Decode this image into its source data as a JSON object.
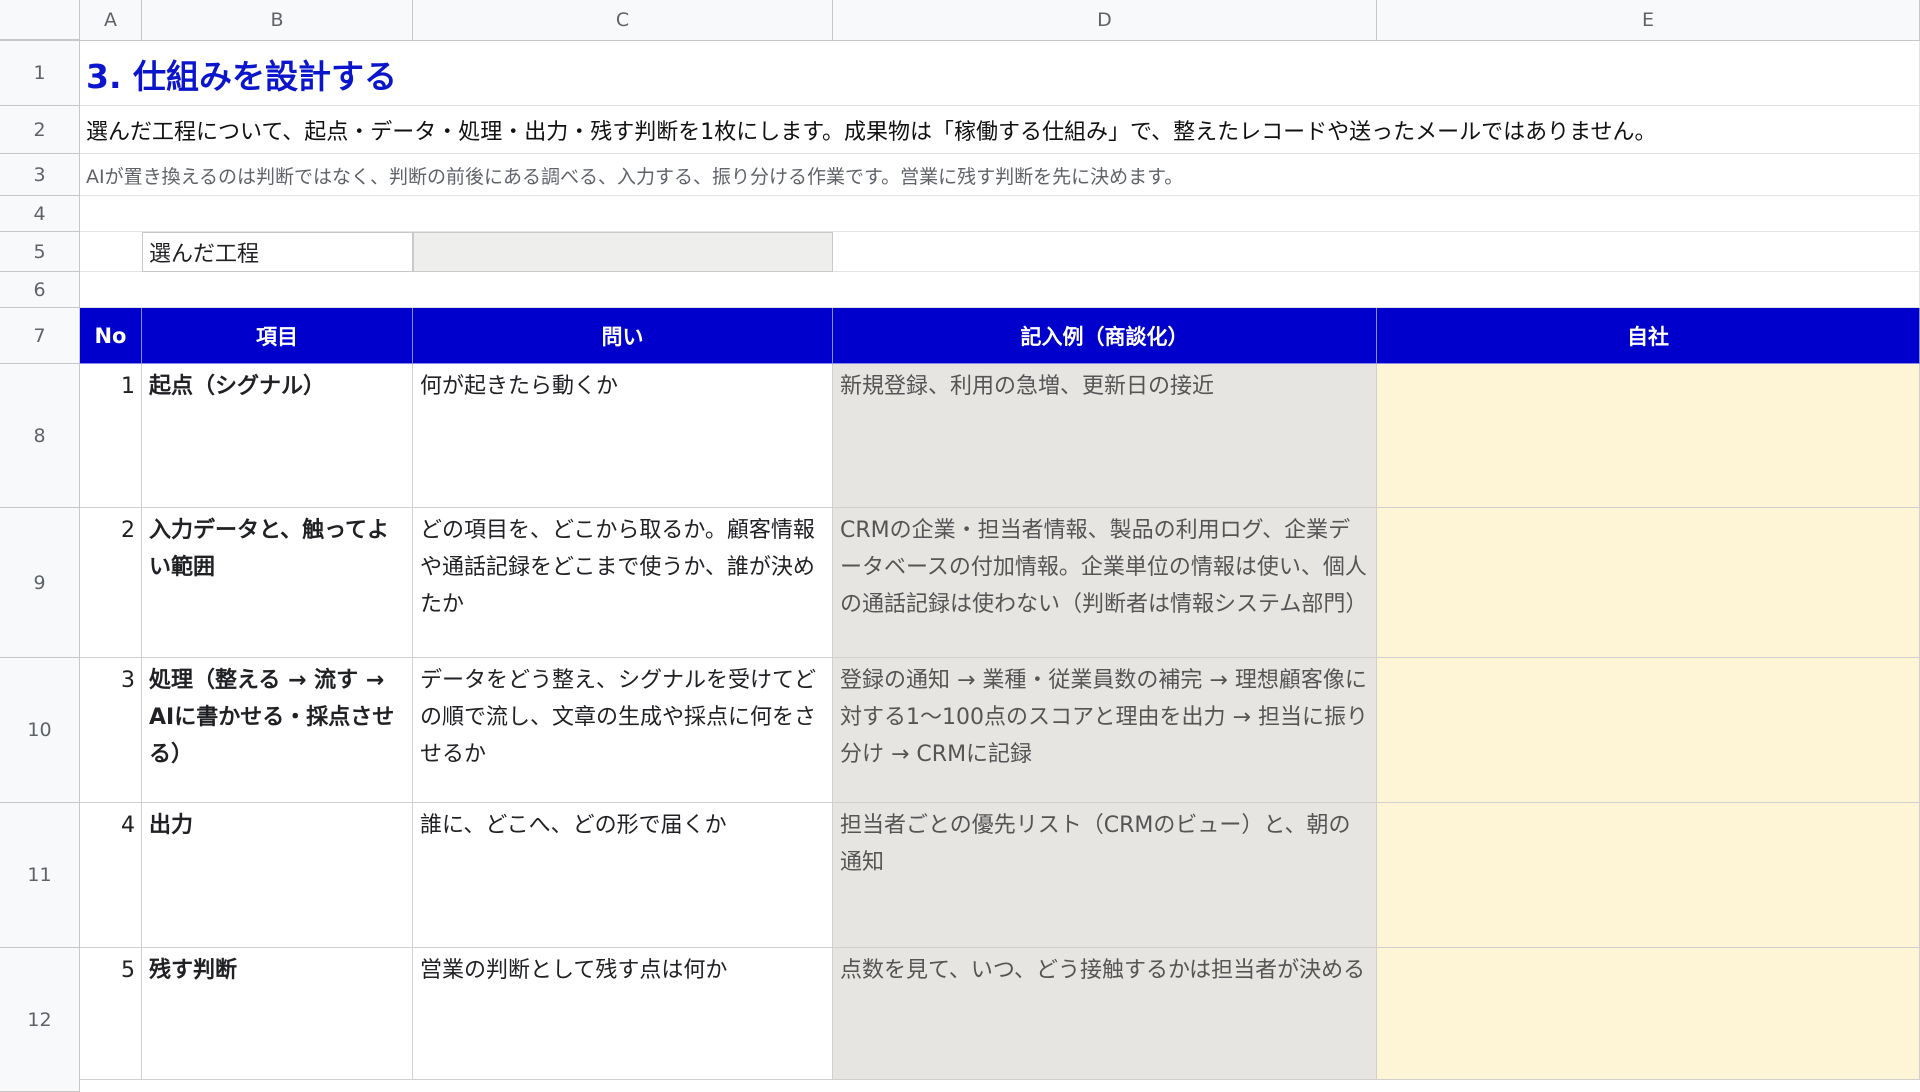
{
  "columns": [
    "A",
    "B",
    "C",
    "D",
    "E"
  ],
  "rows": [
    "1",
    "2",
    "3",
    "4",
    "5",
    "6",
    "7",
    "8",
    "9",
    "10",
    "11",
    "12"
  ],
  "title": "3. 仕組みを設計する",
  "description": "選んだ工程について、起点・データ・処理・出力・残す判断を1枚にします。成果物は「稼働する仕組み」で、整えたレコードや送ったメールではありません。",
  "note": "AIが置き換えるのは判断ではなく、判断の前後にある調べる、入力する、振り分ける作業です。営業に残す判断を先に決めます。",
  "selected_process": {
    "label": "選んだ工程",
    "value": ""
  },
  "table": {
    "headers": [
      "No",
      "項目",
      "問い",
      "記入例（商談化）",
      "自社"
    ],
    "rows": [
      {
        "no": "1",
        "item": "起点（シグナル）",
        "question": "何が起きたら動くか",
        "example": "新規登録、利用の急増、更新日の接近",
        "own": ""
      },
      {
        "no": "2",
        "item": "入力データと、触ってよい範囲",
        "question": "どの項目を、どこから取るか。顧客情報や通話記録をどこまで使うか、誰が決めたか",
        "example": "CRMの企業・担当者情報、製品の利用ログ、企業データベースの付加情報。企業単位の情報は使い、個人の通話記録は使わない（判断者は情報システム部門）",
        "own": ""
      },
      {
        "no": "3",
        "item": "処理（整える → 流す → AIに書かせる・採点させる）",
        "question": "データをどう整え、シグナルを受けてどの順で流し、文章の生成や採点に何をさせるか",
        "example": "登録の通知 → 業種・従業員数の補完 → 理想顧客像に対する1〜100点のスコアと理由を出力 → 担当に振り分け → CRMに記録",
        "own": ""
      },
      {
        "no": "4",
        "item": "出力",
        "question": "誰に、どこへ、どの形で届くか",
        "example": "担当者ごとの優先リスト（CRMのビュー）と、朝の通知",
        "own": ""
      },
      {
        "no": "5",
        "item": "残す判断",
        "question": "営業の判断として残す点は何か",
        "example": "点数を見て、いつ、どう接触するかは担当者が決める",
        "own": ""
      }
    ]
  }
}
